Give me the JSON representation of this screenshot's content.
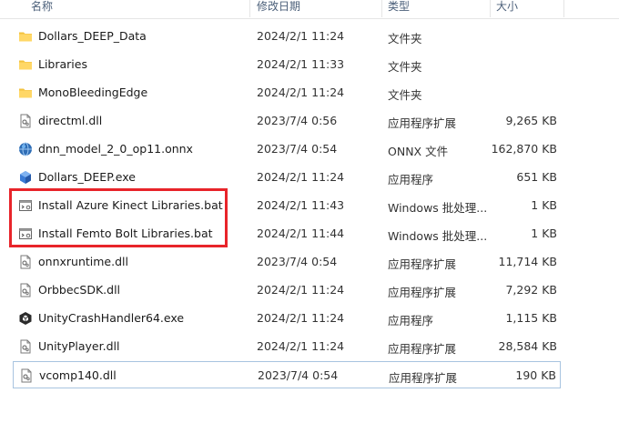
{
  "columns": {
    "name": "名称",
    "date": "修改日期",
    "type": "类型",
    "size": "大小"
  },
  "rows": [
    {
      "icon": "folder-icon",
      "name": "Dollars_DEEP_Data",
      "date": "2024/2/1 11:24",
      "type": "文件夹",
      "size": ""
    },
    {
      "icon": "folder-icon",
      "name": "Libraries",
      "date": "2024/2/1 11:33",
      "type": "文件夹",
      "size": ""
    },
    {
      "icon": "folder-icon",
      "name": "MonoBleedingEdge",
      "date": "2024/2/1 11:24",
      "type": "文件夹",
      "size": ""
    },
    {
      "icon": "dll-file-icon",
      "name": "directml.dll",
      "date": "2023/7/4 0:56",
      "type": "应用程序扩展",
      "size": "9,265 KB"
    },
    {
      "icon": "onnx-file-icon",
      "name": "dnn_model_2_0_op11.onnx",
      "date": "2023/7/4 0:54",
      "type": "ONNX 文件",
      "size": "162,870 KB"
    },
    {
      "icon": "exe-app-icon",
      "name": "Dollars_DEEP.exe",
      "date": "2024/2/1 11:24",
      "type": "应用程序",
      "size": "651 KB"
    },
    {
      "icon": "bat-file-icon",
      "name": "Install Azure Kinect Libraries.bat",
      "date": "2024/2/1 11:43",
      "type": "Windows 批处理...",
      "size": "1 KB"
    },
    {
      "icon": "bat-file-icon",
      "name": "Install Femto Bolt Libraries.bat",
      "date": "2024/2/1 11:44",
      "type": "Windows 批处理...",
      "size": "1 KB"
    },
    {
      "icon": "dll-file-icon",
      "name": "onnxruntime.dll",
      "date": "2023/7/4 0:54",
      "type": "应用程序扩展",
      "size": "11,714 KB"
    },
    {
      "icon": "dll-file-icon",
      "name": "OrbbecSDK.dll",
      "date": "2024/2/1 11:24",
      "type": "应用程序扩展",
      "size": "7,292 KB"
    },
    {
      "icon": "unity-crash-icon",
      "name": "UnityCrashHandler64.exe",
      "date": "2024/2/1 11:24",
      "type": "应用程序",
      "size": "1,115 KB"
    },
    {
      "icon": "dll-file-icon",
      "name": "UnityPlayer.dll",
      "date": "2024/2/1 11:24",
      "type": "应用程序扩展",
      "size": "28,584 KB"
    },
    {
      "icon": "dll-file-icon",
      "name": "vcomp140.dll",
      "date": "2023/7/4 0:54",
      "type": "应用程序扩展",
      "size": "190 KB"
    }
  ],
  "colors": {
    "folder": "#f3c23d",
    "highlight_border": "#e8242a",
    "selection_border": "#a8c4e0"
  }
}
